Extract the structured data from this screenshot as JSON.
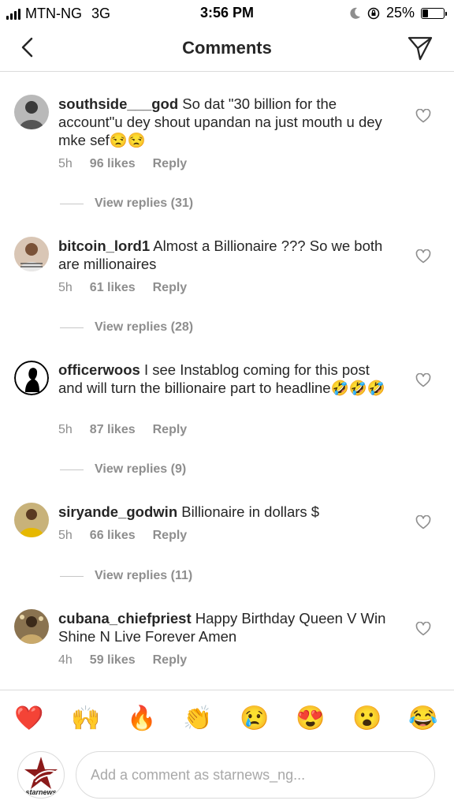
{
  "status_bar": {
    "carrier": "MTN-NG",
    "network": "3G",
    "time": "3:56 PM",
    "battery": "25%",
    "battery_level": 0.25
  },
  "header": {
    "title": "Comments",
    "back_icon": "chevron-left-icon",
    "send_icon": "paper-plane-icon"
  },
  "comments": [
    {
      "username": "southside___god",
      "text": "So dat \"30 billion for the account\"u dey shout upandan na just mouth u dey mke sef😒😒",
      "time": "5h",
      "likes": "96 likes",
      "reply": "Reply",
      "view_replies": "View replies (31)"
    },
    {
      "username": "bitcoin_lord1",
      "text": "Almost a Billionaire ??? So we both are millionaires",
      "time": "5h",
      "likes": "61 likes",
      "reply": "Reply",
      "view_replies": "View replies (28)"
    },
    {
      "username": "officerwoos",
      "text": "I see Instablog coming for this post and will turn the billionaire part to headline🤣🤣🤣",
      "time": "5h",
      "likes": "87 likes",
      "reply": "Reply",
      "view_replies": "View replies (9)"
    },
    {
      "username": "siryande_godwin",
      "text": "Billionaire in dollars $",
      "time": "5h",
      "likes": "66 likes",
      "reply": "Reply",
      "view_replies": "View replies (11)"
    },
    {
      "username": "cubana_chiefpriest",
      "text": "Happy Birthday Queen V Win Shine N Live Forever Amen",
      "time": "4h",
      "likes": "59 likes",
      "reply": "Reply"
    }
  ],
  "emoji_bar": [
    "❤️",
    "🙌",
    "🔥",
    "👏",
    "😢",
    "😍",
    "😮",
    "😂"
  ],
  "composer": {
    "placeholder": "Add a comment as starnews_ng...",
    "avatar_label": "starnews"
  }
}
